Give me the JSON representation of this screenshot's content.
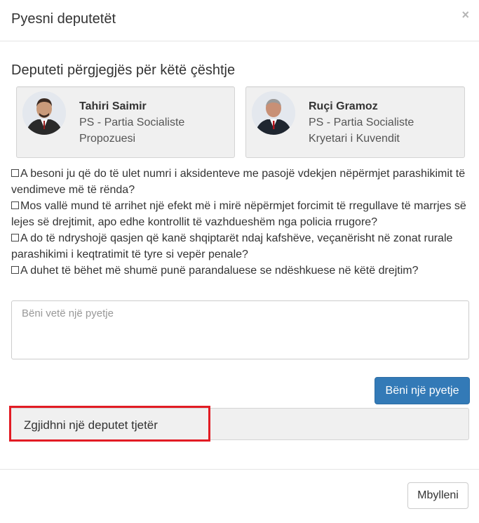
{
  "modal": {
    "title": "Pyesni deputetët",
    "close_glyph": "×"
  },
  "section": {
    "heading": "Deputeti përgjegjës për këtë çështje"
  },
  "deputies": [
    {
      "name": "Tahiri Saimir",
      "party": "PS - Partia Socialiste",
      "role": "Propozuesi",
      "avatar_icon": "person-photo"
    },
    {
      "name": "Ruçi Gramoz",
      "party": "PS - Partia Socialiste",
      "role": "Kryetari i Kuvendit",
      "avatar_icon": "person-photo"
    }
  ],
  "questions": [
    {
      "text": "A besoni ju që do të ulet numri i aksidenteve me pasojë vdekjen nëpërmjet parashikimit të vendimeve më të rënda?",
      "checked": false
    },
    {
      "text": "Mos vallë mund të arrihet një efekt më i mirë nëpërmjet forcimit të rregullave të marrjes së lejes së drejtimit, apo edhe kontrollit të vazhdueshëm nga policia rrugore?",
      "checked": false
    },
    {
      "text": "A do të ndryshojë qasjen që kanë shqiptarët ndaj kafshëve, veçanërisht në zonat rurale parashikimi i keqtratimit të tyre si vepër penale?",
      "checked": false
    },
    {
      "text": "A duhet të bëhet më shumë punë parandaluese se ndëshkuese në këtë drejtim?",
      "checked": false
    }
  ],
  "ask": {
    "placeholder": "Bëni vetë një pyetje",
    "value": "",
    "button_label": "Bëni një pyetje"
  },
  "choose_other": {
    "label": "Zgjidhni një deputet tjetër"
  },
  "footer": {
    "close_label": "Mbylleni"
  },
  "colors": {
    "primary": "#337ab7",
    "highlight": "#e21c24",
    "card_bg": "#f0f0f0"
  }
}
